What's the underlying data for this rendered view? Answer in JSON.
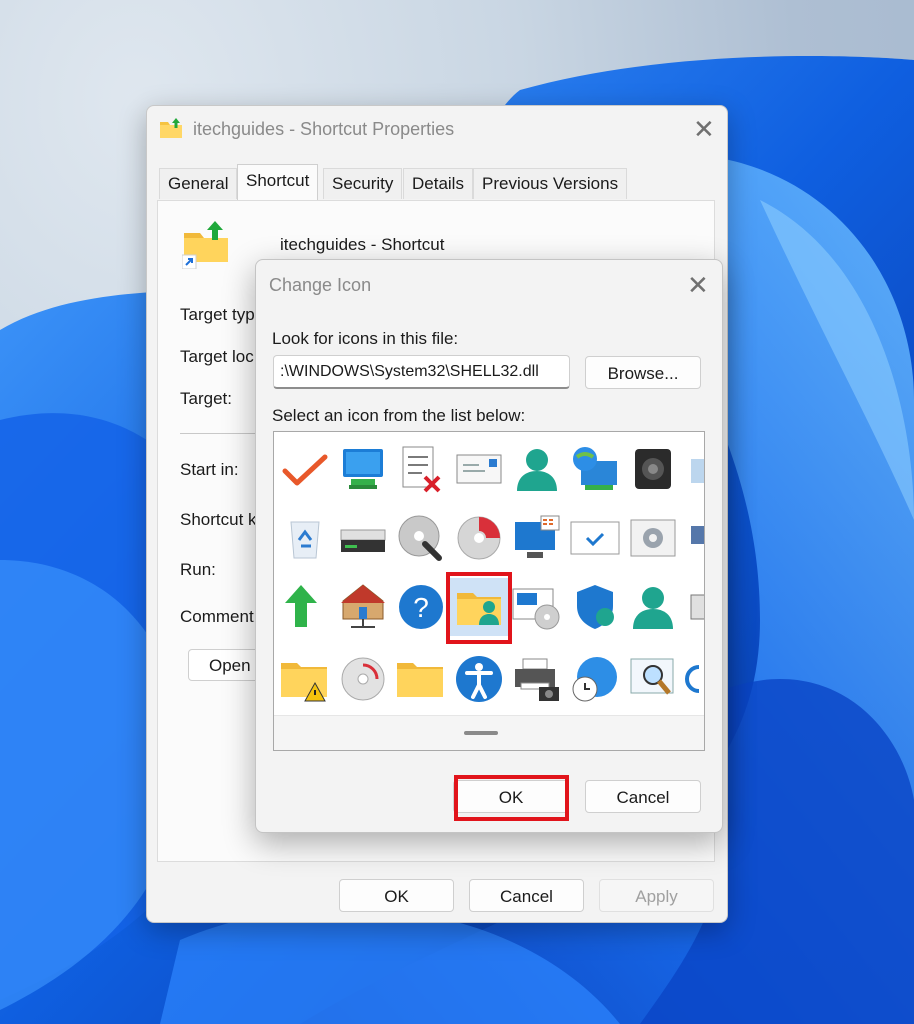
{
  "properties_window": {
    "title": "itechguides - Shortcut Properties",
    "tabs": [
      {
        "label": "General"
      },
      {
        "label": "Shortcut"
      },
      {
        "label": "Security"
      },
      {
        "label": "Details"
      },
      {
        "label": "Previous Versions"
      }
    ],
    "active_tab": "Shortcut",
    "shortcut_name": "itechguides - Shortcut",
    "field_labels": {
      "target_type": "Target typ",
      "target_location": "Target loc",
      "target": "Target:",
      "start_in": "Start in:",
      "shortcut_key": "Shortcut k",
      "run": "Run:",
      "comment": "Comment:"
    },
    "open_button": "Open",
    "buttons": {
      "ok": "OK",
      "cancel": "Cancel",
      "apply": "Apply"
    }
  },
  "change_icon_dialog": {
    "title": "Change Icon",
    "file_label": "Look for icons in this file:",
    "file_path": ":\\WINDOWS\\System32\\SHELL32.dll",
    "browse_button": "Browse...",
    "list_label": "Select an icon from the list below:",
    "icons": [
      [
        "checkmark-icon",
        "monitor-icon",
        "task-list-delete-icon",
        "envelope-icon",
        "user-icon",
        "network-globe-computer-icon",
        "speaker-icon",
        "partial-icon"
      ],
      [
        "recycle-bin-icon",
        "drive-icon",
        "cd-search-icon",
        "cd-red-icon",
        "computer-window-icon",
        "checkbox-window-icon",
        "gear-window-icon",
        "partial-icon"
      ],
      [
        "green-arrow-icon",
        "home-network-icon",
        "help-icon",
        "shared-folder-user-icon",
        "window-cd-icon",
        "shield-icon",
        "user-icon",
        "partial-icon"
      ],
      [
        "folder-warning-icon",
        "cd-gray-icon",
        "folder-icon",
        "accessibility-icon",
        "printer-camera-icon",
        "globe-clock-icon",
        "magnifier-window-icon",
        "partial-icon"
      ]
    ],
    "selected_icon": "shared-folder-user-icon",
    "buttons": {
      "ok": "OK",
      "cancel": "Cancel"
    },
    "highlight_color": "#e1141b"
  }
}
